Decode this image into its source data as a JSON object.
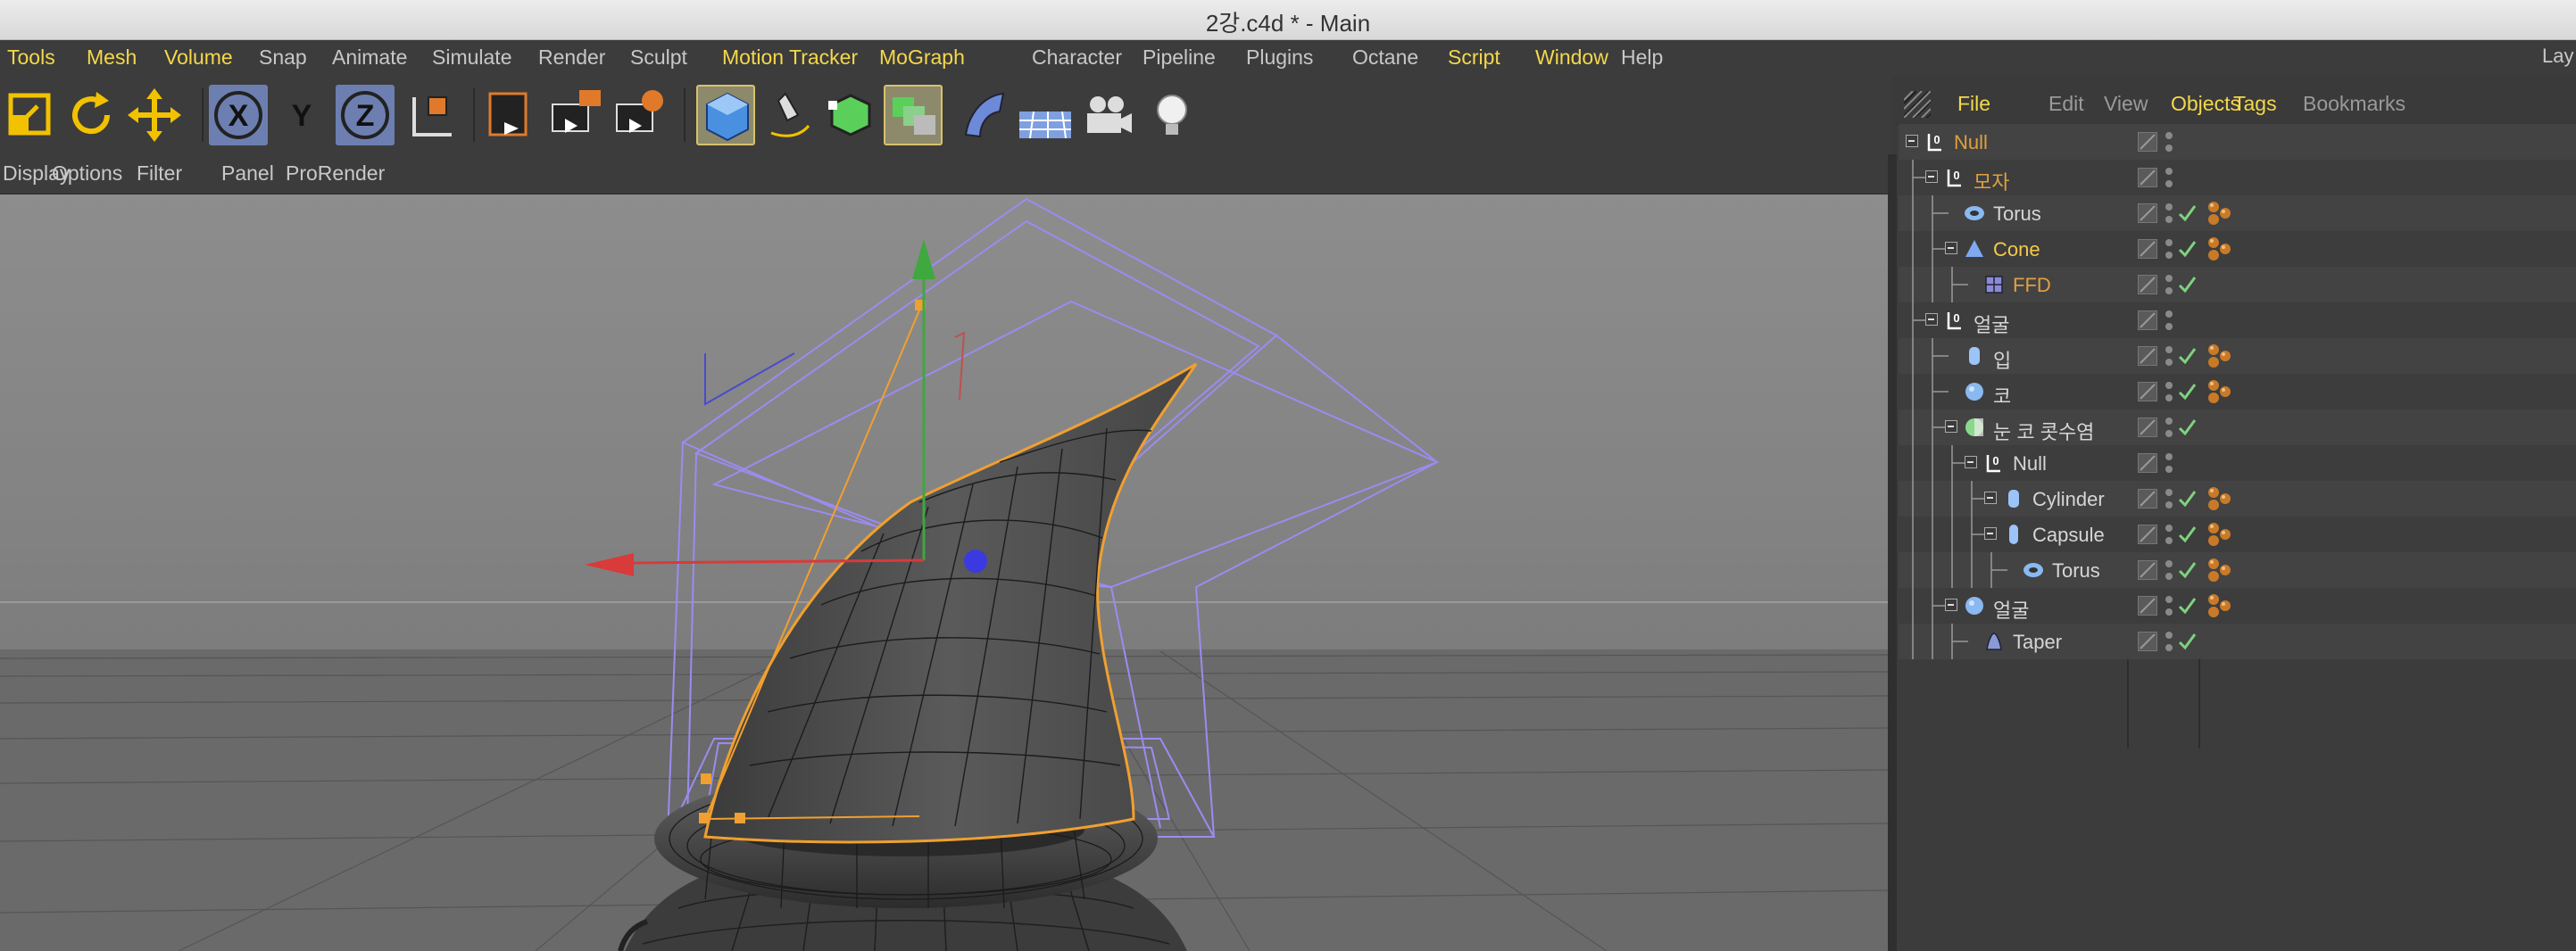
{
  "window": {
    "title": "2강.c4d * - Main"
  },
  "menubar": [
    {
      "label": "Tools",
      "hl": true
    },
    {
      "label": "Mesh",
      "hl": true
    },
    {
      "label": "Volume",
      "hl": true
    },
    {
      "label": "Snap",
      "hl": false
    },
    {
      "label": "Animate",
      "hl": false
    },
    {
      "label": "Simulate",
      "hl": false
    },
    {
      "label": "Render",
      "hl": false
    },
    {
      "label": "Sculpt",
      "hl": false
    },
    {
      "label": "Motion Tracker",
      "hl": true
    },
    {
      "label": "MoGraph",
      "hl": true
    },
    {
      "label": "Character",
      "hl": false
    },
    {
      "label": "Pipeline",
      "hl": false
    },
    {
      "label": "Plugins",
      "hl": false
    },
    {
      "label": "Octane",
      "hl": false
    },
    {
      "label": "Script",
      "hl": true
    },
    {
      "label": "Window",
      "hl": true
    },
    {
      "label": "Help",
      "hl": false
    }
  ],
  "layout_label": "Lay",
  "toolbar": [
    {
      "icon": "scale-icon"
    },
    {
      "icon": "rotate-icon"
    },
    {
      "icon": "move-icon"
    },
    {
      "icon": "x-axis-icon",
      "text": "X"
    },
    {
      "icon": "y-axis-icon",
      "text": "Y"
    },
    {
      "icon": "z-axis-icon",
      "text": "Z"
    },
    {
      "icon": "coordinate-system-icon"
    },
    {
      "icon": "render-view-icon"
    },
    {
      "icon": "render-picture-viewer-icon"
    },
    {
      "icon": "render-settings-icon"
    },
    {
      "icon": "cube-icon"
    },
    {
      "icon": "pen-icon"
    },
    {
      "icon": "subdivision-icon"
    },
    {
      "icon": "cloner-icon"
    },
    {
      "icon": "deformer-icon"
    },
    {
      "icon": "floor-icon"
    },
    {
      "icon": "camera-icon"
    },
    {
      "icon": "light-icon"
    }
  ],
  "viewport_menu": [
    "Display",
    "Options",
    "Filter",
    "Panel",
    "ProRender"
  ],
  "objects_panel": {
    "tabs": [
      {
        "label": "File",
        "hl": true
      },
      {
        "label": "Edit",
        "hl": false
      },
      {
        "label": "View",
        "hl": false
      },
      {
        "label": "Objects",
        "hl": true
      },
      {
        "label": "Tags",
        "hl": true
      },
      {
        "label": "Bookmarks",
        "hl": false
      }
    ],
    "items": [
      {
        "name": "Null",
        "indent": 0,
        "icon": "null-icon",
        "state": "active",
        "check": false,
        "tags": false
      },
      {
        "name": "모자",
        "indent": 1,
        "icon": "null-icon",
        "state": "active",
        "check": false,
        "tags": false
      },
      {
        "name": "Torus",
        "indent": 2,
        "icon": "torus-icon",
        "state": "normal",
        "check": true,
        "tags": true
      },
      {
        "name": "Cone",
        "indent": 2,
        "icon": "cone-icon",
        "state": "selected",
        "check": true,
        "tags": true
      },
      {
        "name": "FFD",
        "indent": 3,
        "icon": "ffd-icon",
        "state": "active",
        "check": true,
        "tags": false
      },
      {
        "name": "얼굴",
        "indent": 1,
        "icon": "null-icon",
        "state": "normal",
        "check": false,
        "tags": false
      },
      {
        "name": "입",
        "indent": 2,
        "icon": "cylinder-icon",
        "state": "normal",
        "check": true,
        "tags": true
      },
      {
        "name": "코",
        "indent": 2,
        "icon": "sphere-icon",
        "state": "normal",
        "check": true,
        "tags": true
      },
      {
        "name": "눈 코 콧수염",
        "indent": 2,
        "icon": "symmetry-icon",
        "state": "normal",
        "check": true,
        "tags": false
      },
      {
        "name": "Null",
        "indent": 3,
        "icon": "null-icon",
        "state": "normal",
        "check": false,
        "tags": false
      },
      {
        "name": "Cylinder",
        "indent": 4,
        "icon": "cylinder-icon",
        "state": "normal",
        "check": true,
        "tags": true
      },
      {
        "name": "Capsule",
        "indent": 4,
        "icon": "capsule-icon",
        "state": "normal",
        "check": true,
        "tags": true
      },
      {
        "name": "Torus",
        "indent": 5,
        "icon": "torus-icon",
        "state": "normal",
        "check": true,
        "tags": true
      },
      {
        "name": "얼굴",
        "indent": 2,
        "icon": "sphere-icon",
        "state": "normal",
        "check": true,
        "tags": true
      },
      {
        "name": "Taper",
        "indent": 3,
        "icon": "taper-icon",
        "state": "normal",
        "check": true,
        "tags": false
      }
    ]
  },
  "colors": {
    "highlight_menu": "#f4d84a",
    "selected_object": "#f6c94a",
    "active_object": "#e0a040",
    "check": "#7fd27f",
    "x_axis": "#d93a3a",
    "y_axis": "#3fa83f",
    "z_axis": "#3a3ae0",
    "selection_outline": "#f0a030",
    "deformer_cage": "#9a8cf0"
  }
}
